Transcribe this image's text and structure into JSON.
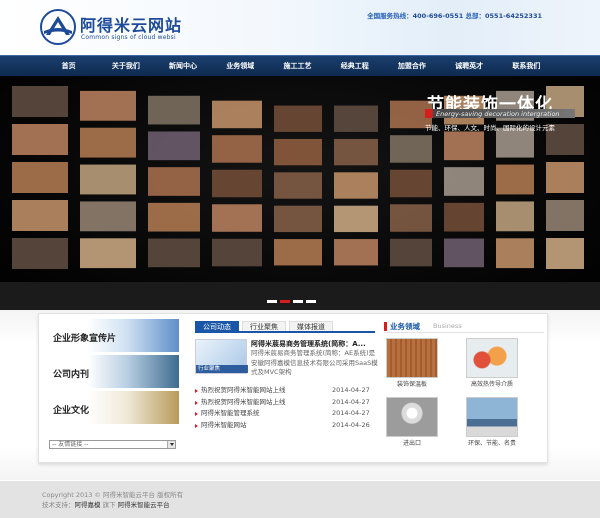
{
  "header": {
    "logo_title": "阿得米云网站",
    "logo_sub": "Common signs of cloud websi",
    "hotline_label": "全国服务热线：",
    "hotline_phone": "400-696-0551",
    "hq_label": " 总部：",
    "hq_phone": "0551-64252331"
  },
  "nav": {
    "items": [
      "首页",
      "关于我们",
      "新闻中心",
      "业务领域",
      "施工工艺",
      "经典工程",
      "加盟合作",
      "诚聘英才",
      "联系我们"
    ]
  },
  "banner": {
    "title": "节能装饰一体化",
    "subtitle_en": "Energy-saving decoration intergration",
    "subtitle_cn": "节能、环保、人文、时尚、国际化的设计元素",
    "dots": 4,
    "active_dot": 1
  },
  "left": {
    "banners": [
      "企业形象宣传片",
      "公司内刊",
      "企业文化"
    ],
    "links_select": "-- 友情链接 --"
  },
  "middle": {
    "tabs": [
      "公司动态",
      "行业聚焦",
      "媒体报道"
    ],
    "featured": {
      "caption": "行业聚焦",
      "title": "阿得米莀易商务管理系统(简称：A...",
      "desc": "阿得米莀易商务管理系统(简称：AE系统)是安徽阿得嘉模信息技术有限公司采用SaaS模式及MVC架构"
    },
    "news": [
      {
        "title": "热烈祝贺阿得米智能网站上线",
        "date": "2014-04-27"
      },
      {
        "title": "热烈祝贺阿得米智能网站上线",
        "date": "2014-04-27"
      },
      {
        "title": "阿得米智能管理系统",
        "date": "2014-04-27"
      },
      {
        "title": "阿得米智能网站",
        "date": "2014-04-26"
      }
    ]
  },
  "right": {
    "title": "业务领域",
    "title_en": "Business",
    "items": [
      {
        "caption": "装饰保温板"
      },
      {
        "caption": "高效热传导介质"
      },
      {
        "caption": "进出口"
      },
      {
        "caption": "环保、节能、名贵"
      }
    ]
  },
  "footer": {
    "line1": "Copyright 2013 © 阿得米智能云平台 版权所有",
    "support_label": "技术支持：",
    "support_brand": "阿得嘉模",
    "support_mid": " 旗下 ",
    "support_platform": "阿得米智能云平台"
  },
  "colors": {
    "brand_blue": "#1d4b9a",
    "nav_bg": "#163a66",
    "accent_red": "#d51e1e",
    "tab_active": "#1a56a8"
  }
}
